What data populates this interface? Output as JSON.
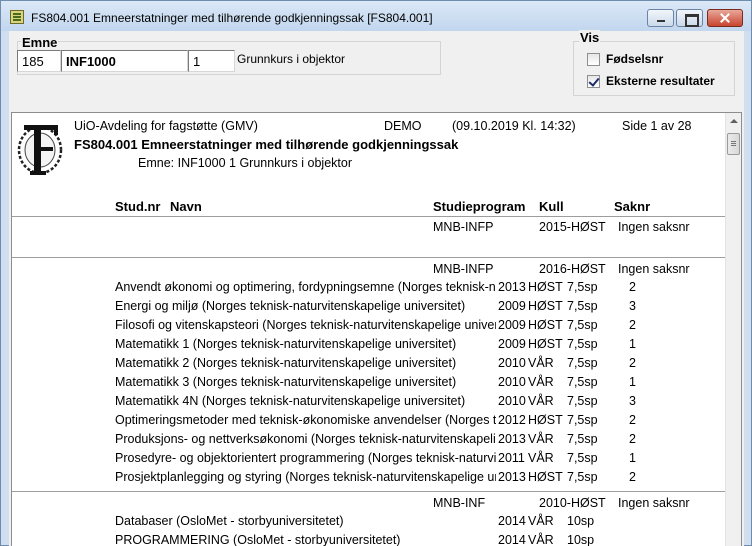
{
  "window": {
    "title": "FS804.001 Emneerstatninger med tilhørende godkjenningssak [FS804.001]"
  },
  "emne": {
    "label": "Emne",
    "code_number": "185",
    "code": "INF1000",
    "version": "1",
    "description": "Grunnkurs i objektor"
  },
  "vis": {
    "label": "Vis",
    "fodselsnr": {
      "label": "Fødselsnr",
      "checked": false
    },
    "eksterne": {
      "label": "Eksterne resultater",
      "checked": true
    }
  },
  "report": {
    "org": "UiO-Avdeling for fagstøtte (GMV)",
    "env": "DEMO",
    "timestamp": "(09.10.2019 Kl. 14:32)",
    "page": "Side 1 av 28",
    "title": "FS804.001 Emneerstatninger med tilhørende godkjenningssak",
    "subtitle": "Emne: INF1000 1 Grunnkurs i objektor",
    "headers": {
      "studnr": "Stud.nr",
      "navn": "Navn",
      "program": "Studieprogram",
      "kull": "Kull",
      "saknr": "Saknr"
    },
    "groups": [
      {
        "program": "MNB-INFP",
        "kull": "2015-HØST",
        "saknr": "Ingen saksnr",
        "rows": []
      },
      {
        "program": "MNB-INFP",
        "kull": "2016-HØST",
        "saknr": "Ingen saksnr",
        "rows": [
          {
            "course": "Anvendt økonomi og optimering, fordypningsemne (Norges teknisk-naturvitenskapelige universitet)",
            "year": "2013",
            "term": "HØST",
            "credits": "7,5sp",
            "count": "2"
          },
          {
            "course": "Energi og miljø (Norges teknisk-naturvitenskapelige universitet)",
            "year": "2009",
            "term": "HØST",
            "credits": "7,5sp",
            "count": "3"
          },
          {
            "course": "Filosofi og vitenskapsteori (Norges teknisk-naturvitenskapelige universitet)",
            "year": "2009",
            "term": "HØST",
            "credits": "7,5sp",
            "count": "2"
          },
          {
            "course": "Matematikk 1 (Norges teknisk-naturvitenskapelige universitet)",
            "year": "2009",
            "term": "HØST",
            "credits": "7,5sp",
            "count": "1"
          },
          {
            "course": "Matematikk 2 (Norges teknisk-naturvitenskapelige universitet)",
            "year": "2010",
            "term": "VÅR",
            "credits": "7,5sp",
            "count": "2"
          },
          {
            "course": "Matematikk 3 (Norges teknisk-naturvitenskapelige universitet)",
            "year": "2010",
            "term": "VÅR",
            "credits": "7,5sp",
            "count": "1"
          },
          {
            "course": "Matematikk 4N (Norges teknisk-naturvitenskapelige universitet)",
            "year": "2010",
            "term": "VÅR",
            "credits": "7,5sp",
            "count": "3"
          },
          {
            "course": "Optimeringsmetoder med teknisk-økonomiske anvendelser (Norges teknisk-naturvitenskapelige universitet)",
            "year": "2012",
            "term": "HØST",
            "credits": "7,5sp",
            "count": "2"
          },
          {
            "course": "Produksjons- og nettverksøkonomi (Norges teknisk-naturvitenskapelige universitet)",
            "year": "2013",
            "term": "VÅR",
            "credits": "7,5sp",
            "count": "2"
          },
          {
            "course": "Prosedyre- og objektorientert programmering (Norges teknisk-naturvitenskapelige universitet)",
            "year": "2011",
            "term": "VÅR",
            "credits": "7,5sp",
            "count": "1"
          },
          {
            "course": "Prosjektplanlegging og styring (Norges teknisk-naturvitenskapelige universitet)",
            "year": "2013",
            "term": "HØST",
            "credits": "7,5sp",
            "count": "2"
          }
        ]
      },
      {
        "program": "MNB-INF",
        "kull": "2010-HØST",
        "saknr": "Ingen saksnr",
        "rows": [
          {
            "course": "Databaser (OsloMet - storbyuniversitetet)",
            "year": "2014",
            "term": "VÅR",
            "credits": "10sp",
            "count": ""
          },
          {
            "course": "PROGRAMMERING (OsloMet - storbyuniversitetet)",
            "year": "2014",
            "term": "VÅR",
            "credits": "10sp",
            "count": ""
          }
        ]
      }
    ]
  }
}
